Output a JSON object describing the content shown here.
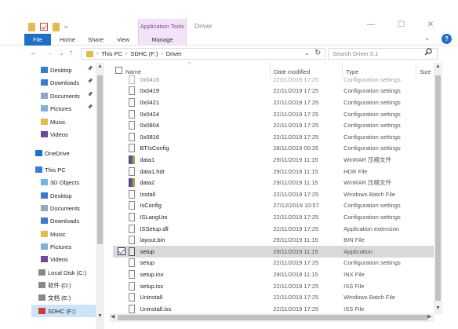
{
  "window": {
    "title": "Driver",
    "context_tab": "Application Tools",
    "minimize": "—",
    "maximize": "☐",
    "close": "✕"
  },
  "ribbon": {
    "tabs": [
      "File",
      "Home",
      "Share",
      "View",
      "Manage"
    ],
    "collapse": "⌄",
    "help": "?"
  },
  "nav": {
    "back": "←",
    "forward": "→",
    "recent": "⌄",
    "up": "↑",
    "breadcrumb": [
      "This PC",
      "SDHC (F:)",
      "Driver"
    ],
    "dropdown": "⌄",
    "refresh": "↻"
  },
  "search": {
    "placeholder": "Search Driver 5.1"
  },
  "columns": {
    "name": "Name",
    "date": "Date modified",
    "type": "Type",
    "size": "Size"
  },
  "navpane": [
    {
      "label": "Desktop",
      "pinned": true,
      "icon": "#3a7bd5"
    },
    {
      "label": "Downloads",
      "pinned": true,
      "icon": "#3a7bd5"
    },
    {
      "label": "Documents",
      "pinned": true,
      "icon": "#8fa7c4"
    },
    {
      "label": "Pictures",
      "pinned": true,
      "icon": "#7fb0d8"
    },
    {
      "label": "Music",
      "pinned": false,
      "icon": "#e8b94a"
    },
    {
      "label": "Videos",
      "pinned": false,
      "icon": "#6b4aa0"
    },
    {
      "label": "OneDrive",
      "pinned": false,
      "icon": "#1e6fc8"
    },
    {
      "label": "This PC",
      "pinned": false,
      "icon": "#3a7bd5"
    },
    {
      "label": "3D Objects",
      "pinned": false,
      "icon": "#6cb6e8"
    },
    {
      "label": "Desktop",
      "pinned": false,
      "icon": "#3a7bd5"
    },
    {
      "label": "Documents",
      "pinned": false,
      "icon": "#8fa7c4"
    },
    {
      "label": "Downloads",
      "pinned": false,
      "icon": "#3a7bd5"
    },
    {
      "label": "Music",
      "pinned": false,
      "icon": "#e8b94a"
    },
    {
      "label": "Pictures",
      "pinned": false,
      "icon": "#7fb0d8"
    },
    {
      "label": "Videos",
      "pinned": false,
      "icon": "#6b4aa0"
    },
    {
      "label": "Local Disk (C:)",
      "pinned": false,
      "icon": "#888888"
    },
    {
      "label": "软件 (D:)",
      "pinned": false,
      "icon": "#888888"
    },
    {
      "label": "文档 (E:)",
      "pinned": false,
      "icon": "#888888"
    },
    {
      "label": "SDHC (F:)",
      "pinned": false,
      "icon": "#d23a3a",
      "selected": true
    }
  ],
  "files": [
    {
      "name": "0x0416",
      "date": "22/11/2019 17:25",
      "type": "Configuration settings",
      "icon": "ini"
    },
    {
      "name": "0x0419",
      "date": "22/11/2019 17:25",
      "type": "Configuration settings",
      "icon": "ini"
    },
    {
      "name": "0x0421",
      "date": "22/11/2019 17:25",
      "type": "Configuration settings",
      "icon": "ini"
    },
    {
      "name": "0x0424",
      "date": "22/11/2019 17:25",
      "type": "Configuration settings",
      "icon": "ini"
    },
    {
      "name": "0x0804",
      "date": "22/11/2019 17:25",
      "type": "Configuration settings",
      "icon": "ini"
    },
    {
      "name": "0x0816",
      "date": "22/11/2019 17:25",
      "type": "Configuration settings",
      "icon": "ini"
    },
    {
      "name": "BTIsConfig",
      "date": "28/11/2019 00:26",
      "type": "Configuration settings",
      "icon": "ini"
    },
    {
      "name": "data1",
      "date": "29/11/2019 11:15",
      "type": "WinRAR 压缩文件",
      "icon": "rar"
    },
    {
      "name": "data1.hdr",
      "date": "29/11/2019 11:15",
      "type": "HDR File",
      "icon": "file"
    },
    {
      "name": "data2",
      "date": "29/11/2019 11:15",
      "type": "WinRAR 压缩文件",
      "icon": "rar"
    },
    {
      "name": "Install",
      "date": "22/11/2019 17:25",
      "type": "Windows Batch File",
      "icon": "bat"
    },
    {
      "name": "IsConfig",
      "date": "27/12/2019 10:57",
      "type": "Configuration settings",
      "icon": "ini"
    },
    {
      "name": "ISLangUni",
      "date": "22/11/2019 17:25",
      "type": "Configuration settings",
      "icon": "ini"
    },
    {
      "name": "ISSetup.dll",
      "date": "22/11/2019 17:25",
      "type": "Application extension",
      "icon": "dll"
    },
    {
      "name": "layout.bin",
      "date": "29/11/2019 11:15",
      "type": "BIN File",
      "icon": "file"
    },
    {
      "name": "setup",
      "date": "29/11/2019 11:15",
      "type": "Application",
      "icon": "app",
      "selected": true
    },
    {
      "name": "setup",
      "date": "22/11/2019 17:25",
      "type": "Configuration settings",
      "icon": "ini"
    },
    {
      "name": "setup.inx",
      "date": "29/11/2019 11:15",
      "type": "INX File",
      "icon": "file"
    },
    {
      "name": "setup.iss",
      "date": "22/11/2019 17:25",
      "type": "ISS File",
      "icon": "file"
    },
    {
      "name": "Uninstall",
      "date": "22/11/2019 17:25",
      "type": "Windows Batch File",
      "icon": "bat"
    },
    {
      "name": "Uninstall.iss",
      "date": "22/11/2019 17:25",
      "type": "ISS File",
      "icon": "file"
    }
  ]
}
